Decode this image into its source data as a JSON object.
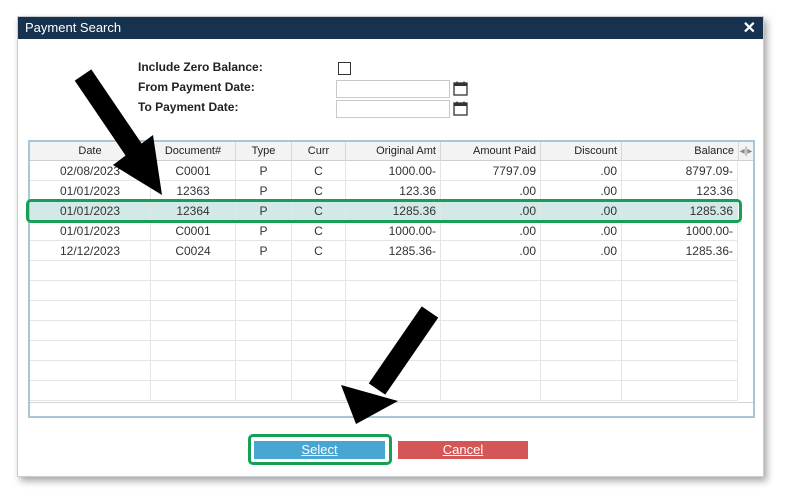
{
  "dialog": {
    "title": "Payment Search",
    "close_glyph": "✕"
  },
  "form": {
    "include_zero_balance_label": "Include Zero Balance:",
    "from_date_label": "From Payment Date:",
    "to_date_label": "To Payment Date:",
    "from_date_value": "",
    "to_date_value": "",
    "include_zero_balance_checked": false
  },
  "grid": {
    "columns": [
      "Date",
      "Document#",
      "Type",
      "Curr",
      "Original Amt",
      "Amount Paid",
      "Discount",
      "Balance"
    ],
    "rows": [
      [
        "02/08/2023",
        "C0001",
        "P",
        "C",
        "1000.00-",
        "7797.09",
        ".00",
        "8797.09-"
      ],
      [
        "01/01/2023",
        "12363",
        "P",
        "C",
        "123.36",
        ".00",
        ".00",
        "123.36"
      ],
      [
        "01/01/2023",
        "12364",
        "P",
        "C",
        "1285.36",
        ".00",
        ".00",
        "1285.36"
      ],
      [
        "01/01/2023",
        "C0001",
        "P",
        "C",
        "1000.00-",
        ".00",
        ".00",
        "1000.00-"
      ],
      [
        "12/12/2023",
        "C0024",
        "P",
        "C",
        "1285.36-",
        ".00",
        ".00",
        "1285.36-"
      ]
    ],
    "selected_row_index": 2
  },
  "buttons": {
    "select_label": "Select",
    "cancel_label": "Cancel"
  },
  "colors": {
    "titlebar": "#16324f",
    "select_button": "#48a6d2",
    "cancel_button": "#d55656",
    "highlight": "#17a055",
    "selected_row": "#d2e9e8"
  }
}
